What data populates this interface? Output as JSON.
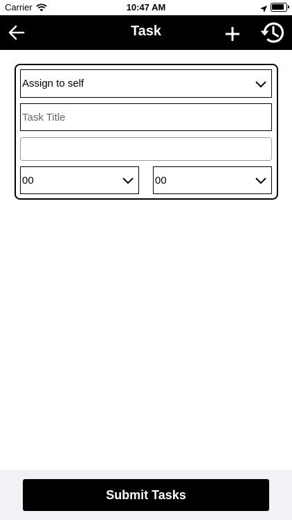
{
  "status_bar": {
    "carrier": "Carrier",
    "time": "10:47 AM",
    "icons": [
      "wifi-icon",
      "location-arrow-icon",
      "battery-icon"
    ]
  },
  "nav": {
    "title": "Task",
    "icons": [
      "back-arrow-icon",
      "plus-icon",
      "history-icon"
    ],
    "background": "#000000",
    "foreground": "#ffffff"
  },
  "form": {
    "assign": {
      "value": "Assign to self"
    },
    "task_title": {
      "value": "",
      "placeholder": "Task Title"
    },
    "description": {
      "value": ""
    },
    "hour": {
      "value": "00"
    },
    "minute": {
      "value": "00"
    }
  },
  "footer": {
    "submit_label": "Submit Tasks",
    "background": "#f2f2f6",
    "button_color": "#000000"
  }
}
